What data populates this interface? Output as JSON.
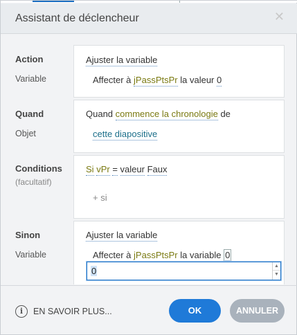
{
  "dialog": {
    "title": "Assistant de déclencheur",
    "close_glyph": "✕"
  },
  "action": {
    "label": "Action",
    "sublabel": "Variable",
    "type": "Ajuster la variable",
    "prefix": "Affecter à",
    "variable": "jPassPtsPr",
    "middle": "la valeur",
    "value": "0"
  },
  "quand": {
    "label": "Quand",
    "sublabel": "Objet",
    "prefix": "Quand",
    "event": "commence la chronologie",
    "suffix": "de",
    "object": "cette diapositive"
  },
  "conditions": {
    "label": "Conditions",
    "sublabel": "(facultatif)",
    "si": "Si",
    "variable": "vPr",
    "operator": "=",
    "kind": "valeur",
    "value": "Faux",
    "add": "+ si"
  },
  "sinon": {
    "label": "Sinon",
    "sublabel": "Variable",
    "type": "Ajuster la variable",
    "prefix": "Affecter à",
    "variable": "jPassPtsPr",
    "middle": "la variable",
    "value": "0",
    "input_value": "0"
  },
  "footer": {
    "info_glyph": "i",
    "info_label": "EN SAVOIR PLUS...",
    "ok_label": "OK",
    "cancel_label": "ANNULER"
  },
  "colors": {
    "accent": "#1f7ad8",
    "variable": "#7a7a12",
    "object": "#1c6f8a",
    "cancel": "#a9b2bc"
  }
}
